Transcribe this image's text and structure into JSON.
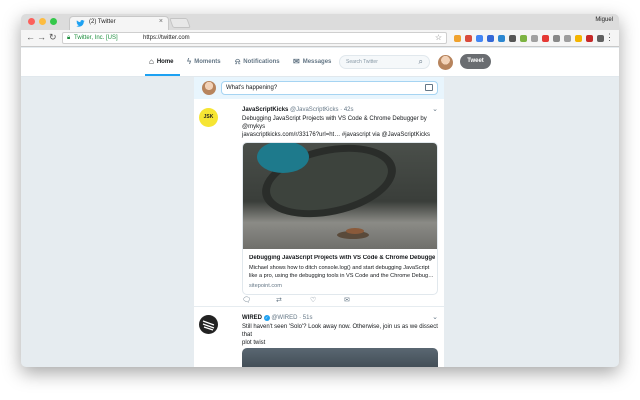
{
  "browser": {
    "tab_title": "(2) Twitter",
    "tab_close": "×",
    "user_name": "Miguel",
    "site_identity": "Twitter, Inc. [US]",
    "url": "https://twitter.com",
    "nav_back": "←",
    "nav_forward": "→",
    "nav_reload": "↻",
    "bookmark_star": "☆",
    "menu": "⋮"
  },
  "twitter_nav": {
    "home": "Home",
    "moments": "Moments",
    "notifications": "Notifications",
    "messages": "Messages",
    "search_placeholder": "Search Twitter",
    "tweet_button": "Tweet"
  },
  "compose": {
    "placeholder": "What's happening?"
  },
  "tweets": [
    {
      "avatar_text": "JSK",
      "name": "JavaScriptKicks",
      "handle": "@JavaScriptKicks",
      "time": "· 42s",
      "text_line1": "Debugging JavaScript Projects with VS Code & Chrome Debugger by @mykys",
      "text_line2": "javascriptkicks.com/r/33176?url=ht… #javascript via @JavaScriptKicks",
      "card_title": "Debugging JavaScript Projects with VS Code & Chrome Debugger —...",
      "card_desc_line1": "Michael shows how to ditch console.log() and start debugging JavaScript",
      "card_desc_line2": "like a pro, using the debugging tools in VS Code and the Chrome Debug…",
      "card_domain": "sitepoint.com"
    },
    {
      "name": "WIRED",
      "verified": "✓",
      "handle": "@WIRED",
      "time": "· 51s",
      "text_line1": "Still haven't seen 'Solo'? Look away now. Otherwise, join us as we dissect that",
      "text_line2": "plot twist"
    }
  ],
  "colors": {
    "twitter_blue": "#1da1f2",
    "tweet_button": "#6a6d71",
    "timeline_bg": "#e6ecf0",
    "jsk_yellow": "#f6e533"
  },
  "icons": {
    "home": "home-icon",
    "moments": "lightning-icon",
    "notifications": "bell-icon",
    "messages": "envelope-icon",
    "search": "search-icon",
    "reply": "reply-icon",
    "retweet": "retweet-icon",
    "like": "heart-icon",
    "dm": "direct-message-icon"
  }
}
